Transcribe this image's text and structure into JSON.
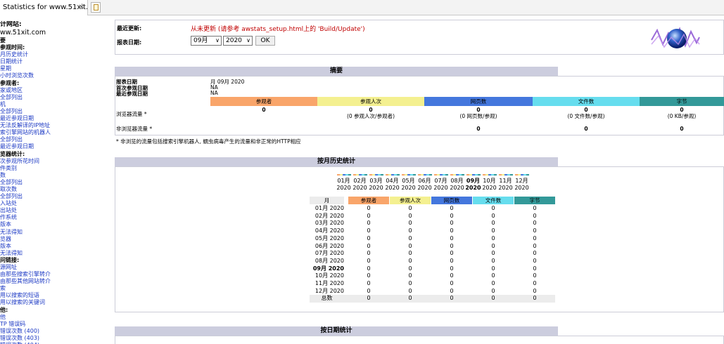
{
  "tab": {
    "title": "Statistics for www.51xit...",
    "close": "✕"
  },
  "menu": {
    "site_head": "计网站:",
    "site": "ww.51xit.com",
    "items": [
      {
        "t": "要",
        "h": true
      },
      {
        "t": "参观时间:",
        "h": true
      },
      {
        "t": "月历史统计",
        "h": false
      },
      {
        "t": "日期统计",
        "h": false
      },
      {
        "t": "星期",
        "h": false
      },
      {
        "t": "小时浏览次数",
        "h": false
      },
      {
        "t": "参观者:",
        "h": true
      },
      {
        "t": "家或地区",
        "h": false
      },
      {
        "t": "全部列出",
        "h": false
      },
      {
        "t": "机",
        "h": false
      },
      {
        "t": "全部列出",
        "h": false
      },
      {
        "t": "最近参观日期",
        "h": false
      },
      {
        "t": "无法反解译的IP地址",
        "h": false
      },
      {
        "t": "索引擎网站的机器人",
        "h": false
      },
      {
        "t": "全部列出",
        "h": false
      },
      {
        "t": "最近参观日期",
        "h": false
      },
      {
        "t": "览器统计:",
        "h": true
      },
      {
        "t": "次参观所花时间",
        "h": false
      },
      {
        "t": "件类别",
        "h": false
      },
      {
        "t": "数",
        "h": false
      },
      {
        "t": "全部列出",
        "h": false
      },
      {
        "t": "取次数",
        "h": false
      },
      {
        "t": "全部列出",
        "h": false
      },
      {
        "t": "入站处",
        "h": false
      },
      {
        "t": "出站处",
        "h": false
      },
      {
        "t": "作系统",
        "h": false
      },
      {
        "t": "版本",
        "h": false
      },
      {
        "t": "无法得知",
        "h": false
      },
      {
        "t": "览器",
        "h": false
      },
      {
        "t": "版本",
        "h": false
      },
      {
        "t": "无法得知",
        "h": false
      },
      {
        "t": "问链接:",
        "h": true
      },
      {
        "t": "源网址",
        "h": false
      },
      {
        "t": "由那些搜索引擎转介",
        "h": false
      },
      {
        "t": "由那些其他网站转介",
        "h": false
      },
      {
        "t": "索",
        "h": false
      },
      {
        "t": "用以搜索的短语",
        "h": false
      },
      {
        "t": "用以搜索的关键词",
        "h": false
      },
      {
        "t": "他:",
        "h": true
      },
      {
        "t": "他",
        "h": false
      },
      {
        "t": "TP 错误码",
        "h": false
      },
      {
        "t": "错误次数 (400)",
        "h": false
      },
      {
        "t": "错误次数 (403)",
        "h": false
      },
      {
        "t": "错误次数 (404)",
        "h": false
      }
    ]
  },
  "top": {
    "last_update_label": "最近更新:",
    "last_update_value": "从未更新 (请参考 awstats_setup.html上的 'Build/Update')",
    "report_date_label": "报表日期:",
    "month_select": "09月",
    "year_select": "2020",
    "ok": "OK"
  },
  "summary": {
    "title": "摘要",
    "rows": [
      {
        "label": "报表日期",
        "value": "月 09月 2020"
      },
      {
        "label": "首次参观日期",
        "value": "NA"
      },
      {
        "label": "最近参观日期",
        "value": "NA"
      }
    ],
    "headers": [
      "参观者",
      "参观人次",
      "网页数",
      "文件数",
      "字节"
    ],
    "viewed_label": "浏览器流量 *",
    "viewed_values": [
      "0",
      "0",
      "0",
      "0",
      "0"
    ],
    "viewed_sub": [
      "",
      "(0 参观人次/参观者)",
      "(0 网页数/参观)",
      "(0 文件数/参观)",
      "(0 KB/参观)"
    ],
    "notviewed_label": "非浏览器流量 *",
    "notviewed_values": [
      "",
      "",
      "0",
      "0",
      "0"
    ],
    "note": "* 非浏览的流量包括搜索引擎机器人, 蠕虫病毒产生的流量和非正常的HTTP相应"
  },
  "monthly": {
    "title": "按月历史统计",
    "months": [
      {
        "m": "01月",
        "y": "2020",
        "cur": false
      },
      {
        "m": "02月",
        "y": "2020",
        "cur": false
      },
      {
        "m": "03月",
        "y": "2020",
        "cur": false
      },
      {
        "m": "04月",
        "y": "2020",
        "cur": false
      },
      {
        "m": "05月",
        "y": "2020",
        "cur": false
      },
      {
        "m": "06月",
        "y": "2020",
        "cur": false
      },
      {
        "m": "07月",
        "y": "2020",
        "cur": false
      },
      {
        "m": "08月",
        "y": "2020",
        "cur": false
      },
      {
        "m": "09月",
        "y": "2020",
        "cur": true
      },
      {
        "m": "10月",
        "y": "2020",
        "cur": false
      },
      {
        "m": "11月",
        "y": "2020",
        "cur": false
      },
      {
        "m": "12月",
        "y": "2020",
        "cur": false
      }
    ],
    "table_headers": [
      "月",
      "参观者",
      "参观人次",
      "网页数",
      "文件数",
      "字节"
    ],
    "rows": [
      {
        "m": "01月 2020",
        "v": [
          "0",
          "0",
          "0",
          "0",
          "0"
        ],
        "cur": false
      },
      {
        "m": "02月 2020",
        "v": [
          "0",
          "0",
          "0",
          "0",
          "0"
        ],
        "cur": false
      },
      {
        "m": "03月 2020",
        "v": [
          "0",
          "0",
          "0",
          "0",
          "0"
        ],
        "cur": false
      },
      {
        "m": "04月 2020",
        "v": [
          "0",
          "0",
          "0",
          "0",
          "0"
        ],
        "cur": false
      },
      {
        "m": "05月 2020",
        "v": [
          "0",
          "0",
          "0",
          "0",
          "0"
        ],
        "cur": false
      },
      {
        "m": "06月 2020",
        "v": [
          "0",
          "0",
          "0",
          "0",
          "0"
        ],
        "cur": false
      },
      {
        "m": "07月 2020",
        "v": [
          "0",
          "0",
          "0",
          "0",
          "0"
        ],
        "cur": false
      },
      {
        "m": "08月 2020",
        "v": [
          "0",
          "0",
          "0",
          "0",
          "0"
        ],
        "cur": false
      },
      {
        "m": "09月 2020",
        "v": [
          "0",
          "0",
          "0",
          "0",
          "0"
        ],
        "cur": true
      },
      {
        "m": "10月 2020",
        "v": [
          "0",
          "0",
          "0",
          "0",
          "0"
        ],
        "cur": false
      },
      {
        "m": "11月 2020",
        "v": [
          "0",
          "0",
          "0",
          "0",
          "0"
        ],
        "cur": false
      },
      {
        "m": "12月 2020",
        "v": [
          "0",
          "0",
          "0",
          "0",
          "0"
        ],
        "cur": false
      }
    ],
    "total_label": "总数",
    "total": [
      "0",
      "0",
      "0",
      "0",
      "0"
    ]
  },
  "daily": {
    "title": "按日期统计"
  },
  "colors": {
    "visitors": "#f9a56a",
    "visits": "#f4f090",
    "pages": "#4477dd",
    "files": "#66ddee",
    "bytes": "#339999",
    "section_bar": "#cccdde",
    "link": "#1c39c4"
  }
}
